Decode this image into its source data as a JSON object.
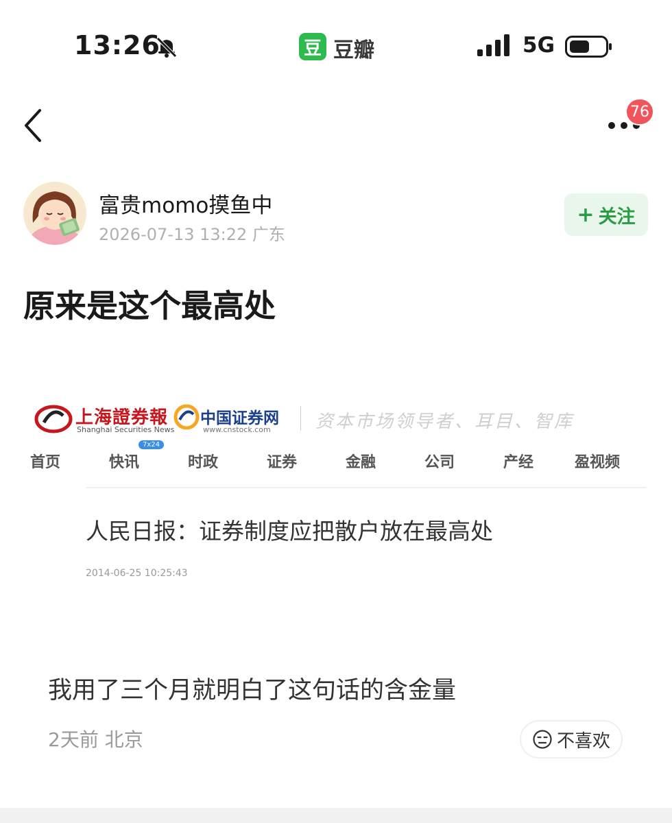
{
  "status_bar": {
    "time": "13:26",
    "app_badge": "豆",
    "app_name": "豆瓣",
    "network": "5G",
    "icons": [
      "bell-off-icon",
      "signal-icon",
      "battery-icon"
    ]
  },
  "nav": {
    "notification_count": "76",
    "icons": [
      "back-chevron-icon",
      "more-dots-icon"
    ]
  },
  "post": {
    "author": "富贵momo摸鱼中",
    "meta": "2026-07-13 13:22  广东",
    "follow_plus": "+",
    "follow_label": "关注",
    "title": "原来是这个最高处"
  },
  "embed": {
    "logo_shzq": "上海證券報",
    "logo_shzq_en": "Shanghai Securities News",
    "logo_cnstock": "中国证券网",
    "logo_cnstock_url": "www.cnstock.com",
    "slogan": "资本市场领导者、耳目、智库",
    "nav_items": [
      "首页",
      "快讯",
      "时政",
      "证券",
      "金融",
      "公司",
      "产经",
      "盈视频"
    ],
    "nav_tag": "7x24",
    "headline": "人民日报：证券制度应把散户放在最高处",
    "date": "2014-06-25 10:25:43"
  },
  "comment": {
    "text": "我用了三个月就明白了这句话的含金量",
    "meta": "2天前 北京",
    "dislike_label": "不喜欢"
  },
  "colors": {
    "accent_green": "#2dbb4f",
    "follow_text": "#2a9c45",
    "badge_red": "#f2545b",
    "shzq_red": "#c8161d",
    "cnstock_blue": "#1b3f8f"
  }
}
